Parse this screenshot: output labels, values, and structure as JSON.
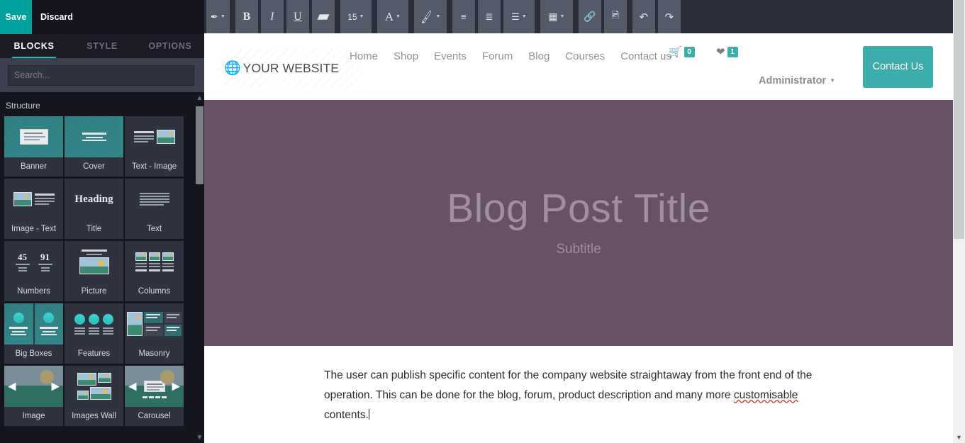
{
  "editor": {
    "save_label": "Save",
    "discard_label": "Discard",
    "tabs": [
      {
        "label": "BLOCKS",
        "active": true
      },
      {
        "label": "STYLE",
        "active": false
      },
      {
        "label": "OPTIONS",
        "active": false
      }
    ],
    "search_placeholder": "Search...",
    "search_value": "",
    "section_label": "Structure",
    "blocks": [
      {
        "label": "Banner",
        "icon": "banner-thumb"
      },
      {
        "label": "Cover",
        "icon": "cover-thumb"
      },
      {
        "label": "Text - Image",
        "icon": "text-image-thumb"
      },
      {
        "label": "Image - Text",
        "icon": "image-text-thumb"
      },
      {
        "label": "Title",
        "icon": "title-thumb"
      },
      {
        "label": "Text",
        "icon": "text-thumb"
      },
      {
        "label": "Numbers",
        "icon": "numbers-thumb"
      },
      {
        "label": "Picture",
        "icon": "picture-thumb"
      },
      {
        "label": "Columns",
        "icon": "columns-thumb"
      },
      {
        "label": "Big Boxes",
        "icon": "big-boxes-thumb"
      },
      {
        "label": "Features",
        "icon": "features-thumb"
      },
      {
        "label": "Masonry",
        "icon": "masonry-thumb"
      },
      {
        "label": "Image",
        "icon": "image-thumb"
      },
      {
        "label": "Images Wall",
        "icon": "images-wall-thumb"
      },
      {
        "label": "Carousel",
        "icon": "carousel-thumb"
      }
    ],
    "numbers_thumb": {
      "first": "45",
      "second": "91"
    },
    "title_thumb_text": "Heading"
  },
  "toolbar": {
    "items": [
      {
        "name": "style-magic-wand",
        "glyph": "✎",
        "caret": true
      },
      {
        "name": "bold",
        "glyph": "B",
        "caret": false
      },
      {
        "name": "italic",
        "glyph": "I",
        "caret": false
      },
      {
        "name": "underline",
        "glyph": "U",
        "caret": false
      },
      {
        "name": "remove-format",
        "glyph": "▱",
        "caret": false
      },
      {
        "name": "font-size",
        "glyph": "15",
        "caret": true
      },
      {
        "name": "font-color",
        "glyph": "A",
        "caret": true
      },
      {
        "name": "background-color",
        "glyph": "✐",
        "caret": true
      },
      {
        "name": "bullet-list",
        "glyph": "≡",
        "caret": false
      },
      {
        "name": "numbered-list",
        "glyph": "≣",
        "caret": false
      },
      {
        "name": "align",
        "glyph": "☰",
        "caret": true
      },
      {
        "name": "table",
        "glyph": "▦",
        "caret": true
      },
      {
        "name": "link",
        "glyph": "⚭",
        "caret": false
      },
      {
        "name": "image",
        "glyph": "⛰",
        "caret": false
      },
      {
        "name": "undo",
        "glyph": "↶",
        "caret": false
      },
      {
        "name": "redo",
        "glyph": "↷",
        "caret": false
      }
    ],
    "font_size_value": "15"
  },
  "site": {
    "logo_text": "YOUR WEBSITE",
    "nav": [
      "Home",
      "Shop",
      "Events",
      "Forum",
      "Blog",
      "Courses",
      "Contact us"
    ],
    "cart_count": "0",
    "favorites_count": "1",
    "user_label": "Administrator",
    "cta_label": "Contact Us",
    "banner_title": "Blog Post Title",
    "banner_subtitle": "Subtitle",
    "body_text_part1": "The user can publish specific content for the company website straightaway from the front end of the operation. This can be done for the blog, forum, product description and many more ",
    "body_text_spellchecked": "customisable",
    "body_text_part2": " contents."
  },
  "colors": {
    "accent_teal": "#00a09d",
    "site_teal": "#3dadac",
    "panel_dark": "#15151f",
    "toolbar_dark": "#2b2d38",
    "banner_purple": "#665266"
  }
}
